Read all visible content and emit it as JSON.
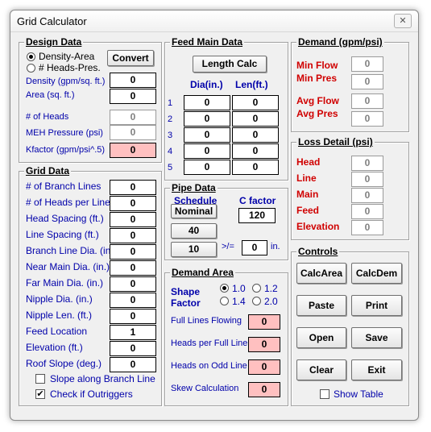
{
  "window": {
    "title": "Grid Calculator",
    "close": "✕"
  },
  "design": {
    "title": "Design Data",
    "radio1": "Density-Area",
    "radio2": "# Heads-Pres.",
    "convert": "Convert",
    "density_label": "Density (gpm/sq. ft.)",
    "density": "0",
    "area_label": "Area (sq. ft.)",
    "area": "0",
    "heads_label": "# of Heads",
    "heads": "0",
    "meh_label": "MEH Pressure (psi)",
    "meh": "0",
    "kfactor_label": "Kfactor (gpm/psi^.5)",
    "kfactor": "0"
  },
  "grid": {
    "title": "Grid Data",
    "rows": [
      {
        "label": "# of Branch Lines",
        "value": "0"
      },
      {
        "label": "# of Heads per Line",
        "value": "0"
      },
      {
        "label": "Head Spacing (ft.)",
        "value": "0"
      },
      {
        "label": "Line Spacing (ft.)",
        "value": "0"
      },
      {
        "label": "Branch Line Dia. (in.)",
        "value": "0"
      },
      {
        "label": "Near Main Dia. (in.)",
        "value": "0"
      },
      {
        "label": "Far Main Dia. (in.)",
        "value": "0"
      },
      {
        "label": "Nipple Dia. (in.)",
        "value": "0"
      },
      {
        "label": "Nipple Len. (ft.)",
        "value": "0"
      },
      {
        "label": "Feed Location",
        "value": "1"
      },
      {
        "label": "Elevation (ft.)",
        "value": "0"
      },
      {
        "label": "Roof Slope (deg.)",
        "value": "0"
      }
    ],
    "slope_chk": "Slope along Branch Line",
    "outrigger_chk": "Check if Outriggers",
    "outrigger_mark": "✔"
  },
  "feed": {
    "title": "Feed Main Data",
    "length_calc": "Length Calc",
    "dia_header": "Dia(in.)",
    "len_header": "Len(ft.)",
    "rows": [
      {
        "n": "1",
        "dia": "0",
        "len": "0"
      },
      {
        "n": "2",
        "dia": "0",
        "len": "0"
      },
      {
        "n": "3",
        "dia": "0",
        "len": "0"
      },
      {
        "n": "4",
        "dia": "0",
        "len": "0"
      },
      {
        "n": "5",
        "dia": "0",
        "len": "0"
      }
    ]
  },
  "pipe": {
    "title": "Pipe Data",
    "schedule": "Schedule",
    "nominal": "Nominal",
    "cfactor_label": "C factor",
    "cfactor": "120",
    "btn40": "40",
    "btn10": "10",
    "ge": ">/=",
    "ge_val": "0",
    "in": "in."
  },
  "demand_area": {
    "title": "Demand Area",
    "shape": "Shape",
    "factor": "Factor",
    "opts": [
      "1.0",
      "1.2",
      "1.4",
      "2.0"
    ],
    "full_lines": "Full Lines Flowing",
    "full_lines_val": "0",
    "heads_per": "Heads per Full Line",
    "heads_per_val": "0",
    "heads_odd": "Heads on Odd Line",
    "heads_odd_val": "0",
    "skew": "Skew Calculation",
    "skew_val": "0"
  },
  "demand": {
    "title": "Demand (gpm/psi)",
    "min_flow": "Min Flow",
    "min_flow_val": "0",
    "min_pres": "Min Pres",
    "min_pres_val": "0",
    "avg_flow": "Avg Flow",
    "avg_flow_val": "0",
    "avg_pres": "Avg Pres",
    "avg_pres_val": "0"
  },
  "loss": {
    "title": "Loss Detail (psi)",
    "rows": [
      {
        "label": "Head",
        "value": "0"
      },
      {
        "label": "Line",
        "value": "0"
      },
      {
        "label": "Main",
        "value": "0"
      },
      {
        "label": "Feed",
        "value": "0"
      },
      {
        "label": "Elevation",
        "value": "0"
      }
    ]
  },
  "controls": {
    "title": "Controls",
    "calc_area": "CalcArea",
    "calc_dem": "CalcDem",
    "paste": "Paste",
    "print": "Print",
    "open": "Open",
    "save": "Save",
    "clear": "Clear",
    "exit": "Exit",
    "show_table": "Show Table"
  }
}
